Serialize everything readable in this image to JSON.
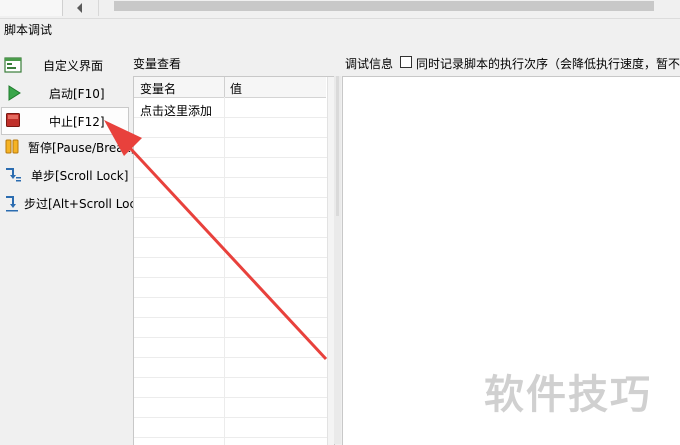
{
  "window": {
    "title": "脚本调试"
  },
  "sidebar": {
    "buttons": [
      {
        "label": "自定义界面",
        "icon": "window-icon"
      },
      {
        "label": "启动[F10]",
        "icon": "play-icon"
      },
      {
        "label": "中止[F12]",
        "icon": "stop-icon"
      },
      {
        "label": "暂停[Pause/Break]",
        "icon": "pause-icon"
      },
      {
        "label": "单步[Scroll Lock]",
        "icon": "step-into-icon"
      },
      {
        "label": "步过[Alt+Scroll Lock]",
        "icon": "step-over-icon"
      }
    ]
  },
  "variables": {
    "title": "变量查看",
    "columns": [
      "变量名",
      "值"
    ],
    "add_row_text": "点击这里添加"
  },
  "debug": {
    "title": "调试信息",
    "checkbox_label": "同时记录脚本的执行次序（会降低执行速度，暂不支",
    "checkbox_checked": false
  },
  "watermark": {
    "text": "软件技巧"
  },
  "colors": {
    "arrow": "#e8413c",
    "accent_green": "#3aa64a",
    "stop_red": "#c0302a"
  }
}
